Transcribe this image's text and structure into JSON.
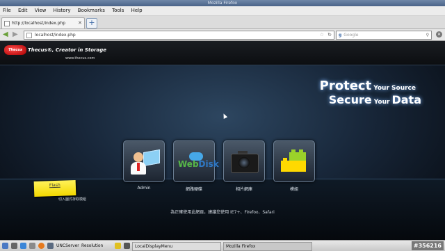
{
  "window": {
    "title": "Mozilla Firefox"
  },
  "menu": [
    "File",
    "Edit",
    "View",
    "History",
    "Bookmarks",
    "Tools",
    "Help"
  ],
  "tab": {
    "title": "http://localhost/index.php"
  },
  "toolbar": {
    "url": "localhost/index.php",
    "search_placeholder": "Google"
  },
  "page": {
    "brand": "Thecus",
    "tagline": "Thecus®, Creator in Storage",
    "brand_url": "www.thecus.com",
    "slogan": {
      "w1": "Protect",
      "w2": "Your Source",
      "w3": "Secure",
      "w4": "Your",
      "w5": "Data"
    },
    "tiles": [
      {
        "label": "Admin",
        "icon": "admin-icon"
      },
      {
        "label": "網路硬碟",
        "icon": "webdisk-icon",
        "logo_a": "Web",
        "logo_b": "Disk"
      },
      {
        "label": "相片網庫",
        "icon": "camera-icon"
      },
      {
        "label": "模組",
        "icon": "modules-icon"
      }
    ],
    "sticky": {
      "label": "Flash",
      "note": "切入圖式存取模組"
    },
    "notice": "為正確使用此網頁，建議您使用 IE7+、Firefox、Safari"
  },
  "taskbar": {
    "items": [
      "UNCServer",
      "Resolution",
      "LocalDisplayMenu",
      "Mozilla Firefox"
    ],
    "badge": "#356216"
  }
}
